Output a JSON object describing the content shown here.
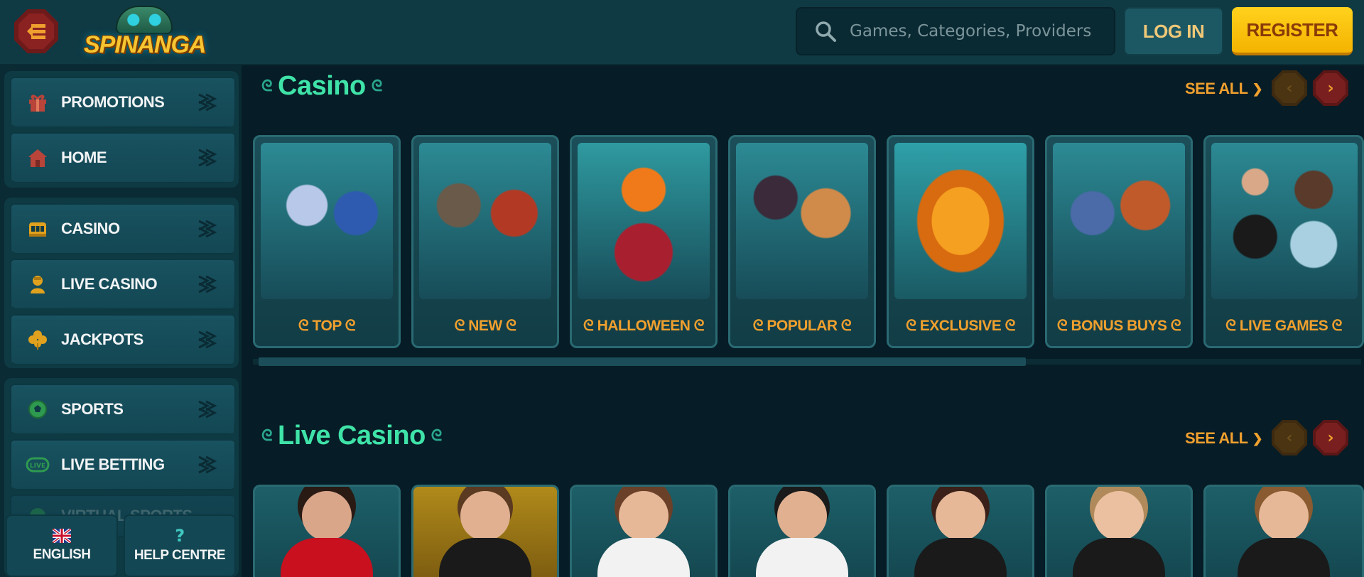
{
  "header": {
    "logo_text": "SPINANGA",
    "search_placeholder": "Games, Categories, Providers",
    "login_label": "LOG IN",
    "register_label": "REGISTER"
  },
  "sidebar": {
    "items": [
      {
        "label": "PROMOTIONS",
        "icon": "gift-icon"
      },
      {
        "label": "HOME",
        "icon": "house-icon"
      },
      {
        "label": "CASINO",
        "icon": "slot-machine-icon"
      },
      {
        "label": "LIVE CASINO",
        "icon": "dealer-icon"
      },
      {
        "label": "JACKPOTS",
        "icon": "clover-icon"
      },
      {
        "label": "SPORTS",
        "icon": "soccer-ball-icon"
      },
      {
        "label": "LIVE BETTING",
        "icon": "live-icon"
      },
      {
        "label": "VIRTUAL SPORTS",
        "icon": "virtual-icon"
      }
    ],
    "language_label": "ENGLISH",
    "help_label": "HELP CENTRE"
  },
  "casino_section": {
    "title": "Casino",
    "see_all": "SEE ALL",
    "cards": [
      {
        "label": "TOP"
      },
      {
        "label": "NEW"
      },
      {
        "label": "HALLOWEEN"
      },
      {
        "label": "POPULAR"
      },
      {
        "label": "EXCLUSIVE"
      },
      {
        "label": "BONUS BUYS"
      },
      {
        "label": "LIVE GAMES"
      }
    ]
  },
  "live_section": {
    "title": "Live Casino",
    "see_all": "SEE ALL"
  },
  "colors": {
    "accent_green": "#3fe3a8",
    "accent_orange": "#f0a02e",
    "register_yellow": "#ffd21d",
    "background": "#061c26"
  }
}
